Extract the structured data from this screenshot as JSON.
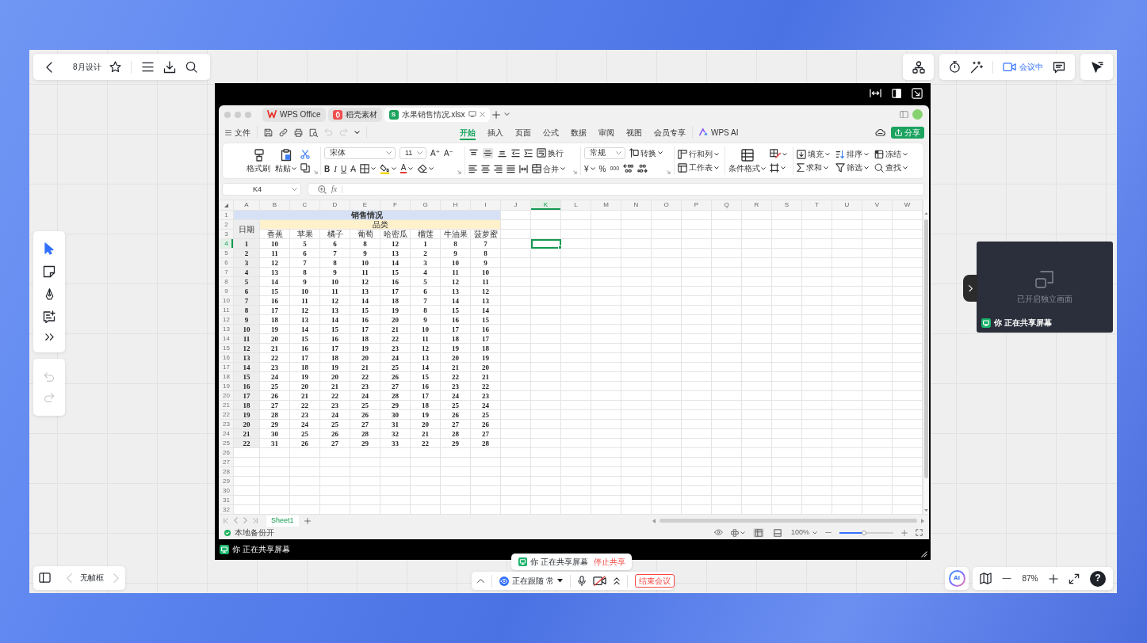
{
  "whiteboard": {
    "title": "8月设计",
    "meeting_status": "会议中",
    "tools": [
      {
        "kind": "pointer",
        "selected": true
      },
      {
        "kind": "sticky-note",
        "selected": false
      },
      {
        "kind": "pen",
        "selected": false
      },
      {
        "kind": "text",
        "selected": false
      },
      {
        "kind": "more",
        "selected": false
      }
    ],
    "history": [
      {
        "kind": "undo",
        "disabled": true
      },
      {
        "kind": "redo",
        "disabled": true
      }
    ],
    "frame_nav": {
      "label": "无帧框",
      "prev_disabled": true,
      "next_disabled": true
    },
    "ai_button": "AI",
    "zoom": "87%",
    "help_button": "?",
    "share_banner": {
      "status": "你 正在共享屏幕",
      "action": "停止共享"
    },
    "meeting_bar": {
      "follow": "正在跟随 常",
      "camera_on": false,
      "end": "结束会议"
    },
    "side_panel": {
      "message": "已开启独立画面",
      "status": "你 正在共享屏幕"
    }
  },
  "shared_screen": {
    "status": "你 正在共享屏幕",
    "wps": {
      "tabs": [
        {
          "kind": "home",
          "label": "WPS Office",
          "selected": false
        },
        {
          "kind": "docer",
          "label": "稻壳素材",
          "selected": false
        },
        {
          "kind": "sheet",
          "badge": "S",
          "label": "水果销售情况.xlsx",
          "selected": true
        }
      ],
      "menu": {
        "file": "文件",
        "undo_disabled": true,
        "redo_disabled": true,
        "tabs": [
          {
            "label": "开始",
            "selected": true
          },
          {
            "label": "插入",
            "selected": false
          },
          {
            "label": "页面",
            "selected": false
          },
          {
            "label": "公式",
            "selected": false
          },
          {
            "label": "数据",
            "selected": false
          },
          {
            "label": "审阅",
            "selected": false
          },
          {
            "label": "视图",
            "selected": false
          },
          {
            "label": "会员专享",
            "selected": false
          }
        ],
        "ai": "WPS AI",
        "share": "分享"
      },
      "ribbon": {
        "format_painter": "格式刷",
        "paste": "粘贴",
        "font": "宋体",
        "font_size": "11",
        "grow": "A⁺",
        "shrink": "A⁻",
        "styles": [
          {
            "kind": "bold",
            "glyph": "B"
          },
          {
            "kind": "italic",
            "glyph": "I"
          },
          {
            "kind": "underline",
            "glyph": "U"
          },
          {
            "kind": "strike",
            "glyph": "A"
          }
        ],
        "font_color": "A",
        "vertical_align": [
          {
            "kind": "top",
            "selected": false
          },
          {
            "kind": "middle",
            "selected": true
          },
          {
            "kind": "bottom",
            "selected": false
          }
        ],
        "wrap": "换行",
        "merge": "合并",
        "number_format": "常规",
        "convert": "转换",
        "currency": "¥",
        "percent": "%",
        "thousands": "000",
        "rows_columns": "行和列",
        "worksheet": "工作表",
        "conditional_format": "条件格式",
        "fill": "填充",
        "sort": "排序",
        "freeze": "冻结",
        "sum": "求和",
        "filter": "筛选",
        "find": "查找"
      },
      "formula_bar": {
        "name_box": "K4",
        "fx": "fx"
      },
      "sheet": {
        "columns": [
          {
            "label": "A",
            "selected": false
          },
          {
            "label": "B",
            "selected": false
          },
          {
            "label": "C",
            "selected": false
          },
          {
            "label": "D",
            "selected": false
          },
          {
            "label": "E",
            "selected": false
          },
          {
            "label": "F",
            "selected": false
          },
          {
            "label": "G",
            "selected": false
          },
          {
            "label": "H",
            "selected": false
          },
          {
            "label": "I",
            "selected": false
          },
          {
            "label": "J",
            "selected": false
          },
          {
            "label": "K",
            "selected": true
          },
          {
            "label": "L",
            "selected": false
          },
          {
            "label": "M",
            "selected": false
          },
          {
            "label": "N",
            "selected": false
          },
          {
            "label": "O",
            "selected": false
          },
          {
            "label": "P",
            "selected": false
          },
          {
            "label": "Q",
            "selected": false
          },
          {
            "label": "R",
            "selected": false
          },
          {
            "label": "S",
            "selected": false
          },
          {
            "label": "T",
            "selected": false
          },
          {
            "label": "U",
            "selected": false
          },
          {
            "label": "V",
            "selected": false
          },
          {
            "label": "W",
            "selected": false
          }
        ],
        "row_numbers": [
          {
            "label": "1",
            "selected": false
          },
          {
            "label": "2",
            "selected": false
          },
          {
            "label": "3",
            "selected": false
          },
          {
            "label": "4",
            "selected": true
          },
          {
            "label": "5",
            "selected": false
          },
          {
            "label": "6",
            "selected": false
          },
          {
            "label": "7",
            "selected": false
          },
          {
            "label": "8",
            "selected": false
          },
          {
            "label": "9",
            "selected": false
          },
          {
            "label": "10",
            "selected": false
          },
          {
            "label": "11",
            "selected": false
          },
          {
            "label": "12",
            "selected": false
          },
          {
            "label": "13",
            "selected": false
          },
          {
            "label": "14",
            "selected": false
          },
          {
            "label": "15",
            "selected": false
          },
          {
            "label": "16",
            "selected": false
          },
          {
            "label": "17",
            "selected": false
          },
          {
            "label": "18",
            "selected": false
          },
          {
            "label": "19",
            "selected": false
          },
          {
            "label": "20",
            "selected": false
          },
          {
            "label": "21",
            "selected": false
          },
          {
            "label": "22",
            "selected": false
          },
          {
            "label": "23",
            "selected": false
          },
          {
            "label": "24",
            "selected": false
          },
          {
            "label": "25",
            "selected": false
          },
          {
            "label": "26",
            "selected": false
          },
          {
            "label": "27",
            "selected": false
          },
          {
            "label": "28",
            "selected": false
          },
          {
            "label": "29",
            "selected": false
          },
          {
            "label": "30",
            "selected": false
          },
          {
            "label": "31",
            "selected": false
          },
          {
            "label": "32",
            "selected": false
          }
        ],
        "title": "销售情况",
        "date_header": "日期",
        "category_header": "品类",
        "fruits": [
          "香蕉",
          "苹果",
          "橘子",
          "葡萄",
          "哈密瓜",
          "榴莲",
          "牛油果",
          "菠萝蜜"
        ],
        "rows": [
          [
            "1",
            "10",
            "5",
            "6",
            "8",
            "12",
            "1",
            "8",
            "7"
          ],
          [
            "2",
            "11",
            "6",
            "7",
            "9",
            "13",
            "2",
            "9",
            "8"
          ],
          [
            "3",
            "12",
            "7",
            "8",
            "10",
            "14",
            "3",
            "10",
            "9"
          ],
          [
            "4",
            "13",
            "8",
            "9",
            "11",
            "15",
            "4",
            "11",
            "10"
          ],
          [
            "5",
            "14",
            "9",
            "10",
            "12",
            "16",
            "5",
            "12",
            "11"
          ],
          [
            "6",
            "15",
            "10",
            "11",
            "13",
            "17",
            "6",
            "13",
            "12"
          ],
          [
            "7",
            "16",
            "11",
            "12",
            "14",
            "18",
            "7",
            "14",
            "13"
          ],
          [
            "8",
            "17",
            "12",
            "13",
            "15",
            "19",
            "8",
            "15",
            "14"
          ],
          [
            "9",
            "18",
            "13",
            "14",
            "16",
            "20",
            "9",
            "16",
            "15"
          ],
          [
            "10",
            "19",
            "14",
            "15",
            "17",
            "21",
            "10",
            "17",
            "16"
          ],
          [
            "11",
            "20",
            "15",
            "16",
            "18",
            "22",
            "11",
            "18",
            "17"
          ],
          [
            "12",
            "21",
            "16",
            "17",
            "19",
            "23",
            "12",
            "19",
            "18"
          ],
          [
            "13",
            "22",
            "17",
            "18",
            "20",
            "24",
            "13",
            "20",
            "19"
          ],
          [
            "14",
            "23",
            "18",
            "19",
            "21",
            "25",
            "14",
            "21",
            "20"
          ],
          [
            "15",
            "24",
            "19",
            "20",
            "22",
            "26",
            "15",
            "22",
            "21"
          ],
          [
            "16",
            "25",
            "20",
            "21",
            "23",
            "27",
            "16",
            "23",
            "22"
          ],
          [
            "17",
            "26",
            "21",
            "22",
            "24",
            "28",
            "17",
            "24",
            "23"
          ],
          [
            "18",
            "27",
            "22",
            "23",
            "25",
            "29",
            "18",
            "25",
            "24"
          ],
          [
            "19",
            "28",
            "23",
            "24",
            "26",
            "30",
            "19",
            "26",
            "25"
          ],
          [
            "20",
            "29",
            "24",
            "25",
            "27",
            "31",
            "20",
            "27",
            "26"
          ],
          [
            "21",
            "30",
            "25",
            "26",
            "28",
            "32",
            "21",
            "28",
            "27"
          ],
          [
            "22",
            "31",
            "26",
            "27",
            "29",
            "33",
            "22",
            "29",
            "28"
          ]
        ]
      },
      "sheet_tabs": [
        {
          "label": "Sheet1",
          "selected": true
        }
      ],
      "status_bar": {
        "backup": "本地备份开",
        "views": [
          {
            "kind": "normal",
            "selected": true
          },
          {
            "kind": "page",
            "selected": false
          }
        ],
        "zoom": "100%",
        "zoom_slider": {
          "level": 0.45
        }
      }
    }
  }
}
